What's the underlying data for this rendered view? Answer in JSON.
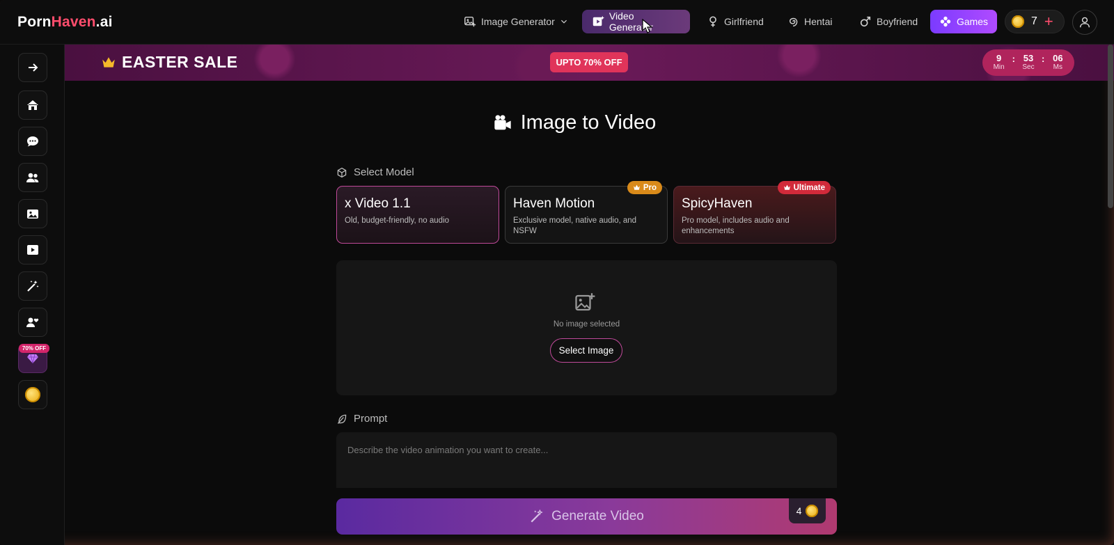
{
  "brand": {
    "part1": "Porn",
    "part2": "Haven",
    "part3": ".ai"
  },
  "nav": {
    "image_generator": "Image Generator",
    "video_generator": "Video Generator",
    "girlfriend": "Girlfriend",
    "hentai": "Hentai",
    "boyfriend": "Boyfriend",
    "games": "Games",
    "credits": "7"
  },
  "sidebar": {
    "items": [
      {
        "name": "expand",
        "icon": "arrow-right-icon"
      },
      {
        "name": "home",
        "icon": "home-icon"
      },
      {
        "name": "chat",
        "icon": "chat-icon"
      },
      {
        "name": "characters",
        "icon": "users-icon"
      },
      {
        "name": "images",
        "icon": "image-icon"
      },
      {
        "name": "videos",
        "icon": "play-icon"
      },
      {
        "name": "magic",
        "icon": "magic-wand-icon"
      },
      {
        "name": "companions",
        "icon": "user-heart-icon"
      },
      {
        "name": "premium",
        "icon": "gem-icon"
      },
      {
        "name": "coins",
        "icon": "coin-icon"
      }
    ],
    "offer_badge": "70% OFF"
  },
  "banner": {
    "title": "EASTER SALE",
    "pill": "UPTO 70% OFF",
    "timer": {
      "min": "9",
      "sec": "53",
      "ms": "06",
      "min_label": "Min",
      "sec_label": "Sec",
      "ms_label": "Ms"
    }
  },
  "main": {
    "title": "Image to Video",
    "select_model_label": "Select Model",
    "models": [
      {
        "title": "x Video 1.1",
        "desc": "Old, budget-friendly, no audio",
        "badge": ""
      },
      {
        "title": "Haven Motion",
        "desc": "Exclusive model, native audio, and NSFW",
        "badge": "Pro"
      },
      {
        "title": "SpicyHaven",
        "desc": "Pro model, includes audio and enhancements",
        "badge": "Ultimate"
      }
    ],
    "no_image": "No image selected",
    "select_image": "Select Image",
    "prompt_label": "Prompt",
    "prompt_placeholder": "Describe the video animation you want to create...",
    "generate": "Generate Video",
    "cost": "4"
  },
  "colors": {
    "accent": "#ff4d6d",
    "purple": "#7b3bff",
    "banner": "#6a1a58",
    "timer": "#b0245c"
  }
}
